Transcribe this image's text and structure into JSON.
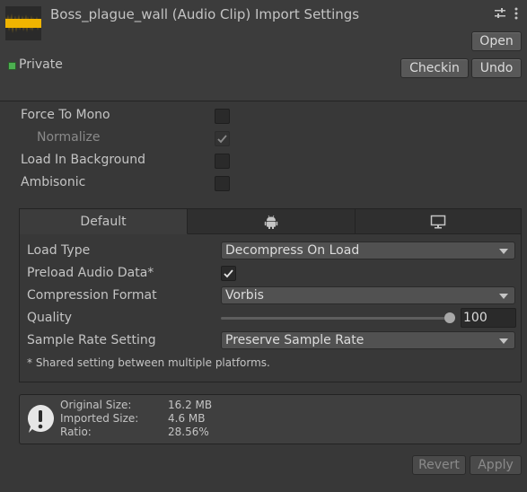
{
  "header": {
    "title": "Boss_plague_wall (Audio Clip) Import Settings",
    "open_label": "Open",
    "checkin_label": "Checkin",
    "undo_label": "Undo",
    "private_label": "Private",
    "icons": [
      "audio-waveform-thumbnail",
      "settings-sliders-icon",
      "kebab-menu-icon",
      "private-status-icon"
    ],
    "colors": {
      "waveform": "#f0b400",
      "private_badge": "#4caf50"
    }
  },
  "options": {
    "force_to_mono": {
      "label": "Force To Mono",
      "checked": false
    },
    "normalize": {
      "label": "Normalize",
      "checked": true,
      "disabled": true
    },
    "load_in_background": {
      "label": "Load In Background",
      "checked": false
    },
    "ambisonic": {
      "label": "Ambisonic",
      "checked": false
    }
  },
  "platform": {
    "tabs": [
      {
        "label": "Default",
        "selected": true
      },
      {
        "icon": "android-icon",
        "selected": false
      },
      {
        "icon": "monitor-icon",
        "selected": false
      }
    ],
    "load_type": {
      "label": "Load Type",
      "value": "Decompress On Load"
    },
    "preload_audio_data": {
      "label": "Preload Audio Data*",
      "checked": true
    },
    "compression_format": {
      "label": "Compression Format",
      "value": "Vorbis"
    },
    "quality": {
      "label": "Quality",
      "value": "100",
      "fraction": 1.0
    },
    "sample_rate_setting": {
      "label": "Sample Rate Setting",
      "value": "Preserve Sample Rate"
    },
    "footnote": "* Shared setting between multiple platforms."
  },
  "info": {
    "icon": "warning-info-icon",
    "original_size_label": "Original Size:",
    "original_size_value": "16.2 MB",
    "imported_size_label": "Imported Size:",
    "imported_size_value": "4.6 MB",
    "ratio_label": "Ratio:",
    "ratio_value": "28.56%"
  },
  "footer": {
    "revert_label": "Revert",
    "apply_label": "Apply"
  }
}
